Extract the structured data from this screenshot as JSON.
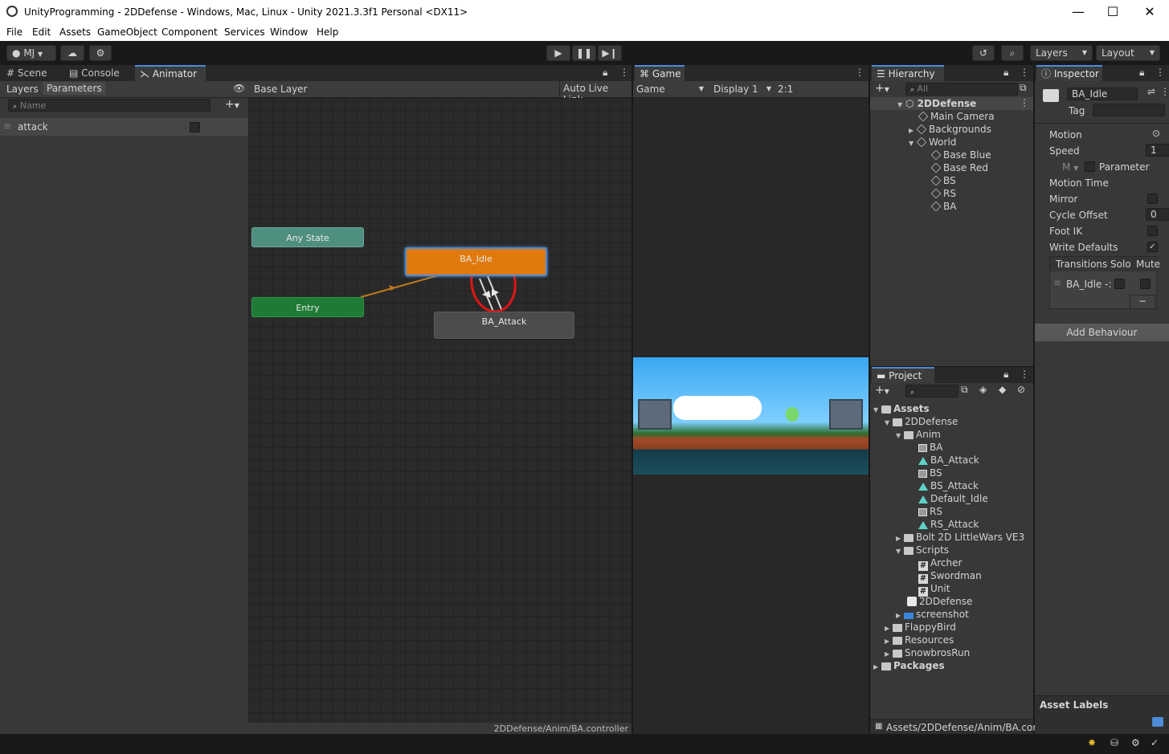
{
  "window": {
    "title": "UnityProgramming - 2DDefense - Windows, Mac, Linux - Unity 2021.3.3f1 Personal <DX11>",
    "minimize": "—",
    "maximize": "☐",
    "close": "✕"
  },
  "menu": [
    "File",
    "Edit",
    "Assets",
    "GameObject",
    "Component",
    "Services",
    "Window",
    "Help"
  ],
  "toolbar": {
    "account": "MJ",
    "layers": "Layers",
    "layout": "Layout"
  },
  "left_tabs": [
    "Scene",
    "Console",
    "Animator"
  ],
  "animator": {
    "layers_tab": "Layers",
    "parameters_tab": "Parameters",
    "search_placeholder": "Name",
    "parameter": "attack",
    "breadcrumb": "Base Layer",
    "auto_live_link": "Auto Live Link",
    "nodes": {
      "any_state": "Any State",
      "entry": "Entry",
      "idle": "BA_Idle",
      "attack": "BA_Attack"
    },
    "path": "2DDefense/Anim/BA.controller"
  },
  "game": {
    "tab": "Game",
    "mode": "Game",
    "display": "Display 1",
    "aspect": "2:1"
  },
  "hierarchy": {
    "tab": "Hierarchy",
    "search_placeholder": "All",
    "scene": "2DDefense",
    "items": [
      "Main Camera",
      "Backgrounds",
      "World",
      "Base Blue",
      "Base Red",
      "BS",
      "RS",
      "BA"
    ]
  },
  "project": {
    "tab": "Project",
    "root": "Assets",
    "folder_2d": "2DDefense",
    "folder_anim": "Anim",
    "anim_items": [
      "BA",
      "BA_Attack",
      "BS",
      "BS_Attack",
      "Default_Idle",
      "RS",
      "RS_Attack"
    ],
    "folder_bolt": "Bolt 2D LittleWars VE3",
    "folder_scripts": "Scripts",
    "scripts": [
      "Archer",
      "Swordman",
      "Unit"
    ],
    "scene_asset": "2DDefense",
    "screenshot": "screenshot",
    "others": [
      "FlappyBird",
      "Resources",
      "SnowbrosRun"
    ],
    "packages": "Packages",
    "path": "Assets/2DDefense/Anim/BA.cor"
  },
  "inspector": {
    "tab": "Inspector",
    "name": "BA_Idle",
    "tag_label": "Tag",
    "motion": "Motion",
    "speed": "Speed",
    "speed_value": "1",
    "multiplier": "M",
    "parameter": "Parameter",
    "motion_time": "Motion Time",
    "mirror": "Mirror",
    "cycle_offset": "Cycle Offset",
    "cycle_value": "0",
    "foot_ik": "Foot IK",
    "write_defaults": "Write Defaults",
    "transitions": "Transitions",
    "solo": "Solo",
    "mute": "Mute",
    "transition_item": "BA_Idle -:",
    "remove": "−",
    "add_behaviour": "Add Behaviour",
    "asset_labels": "Asset Labels"
  },
  "colors": {
    "accent": "#4e8bd6",
    "idle_node": "#e07a0c",
    "entry_node": "#1e7a34",
    "any_state_node": "#4f8f80",
    "annotation": "#e01515"
  }
}
